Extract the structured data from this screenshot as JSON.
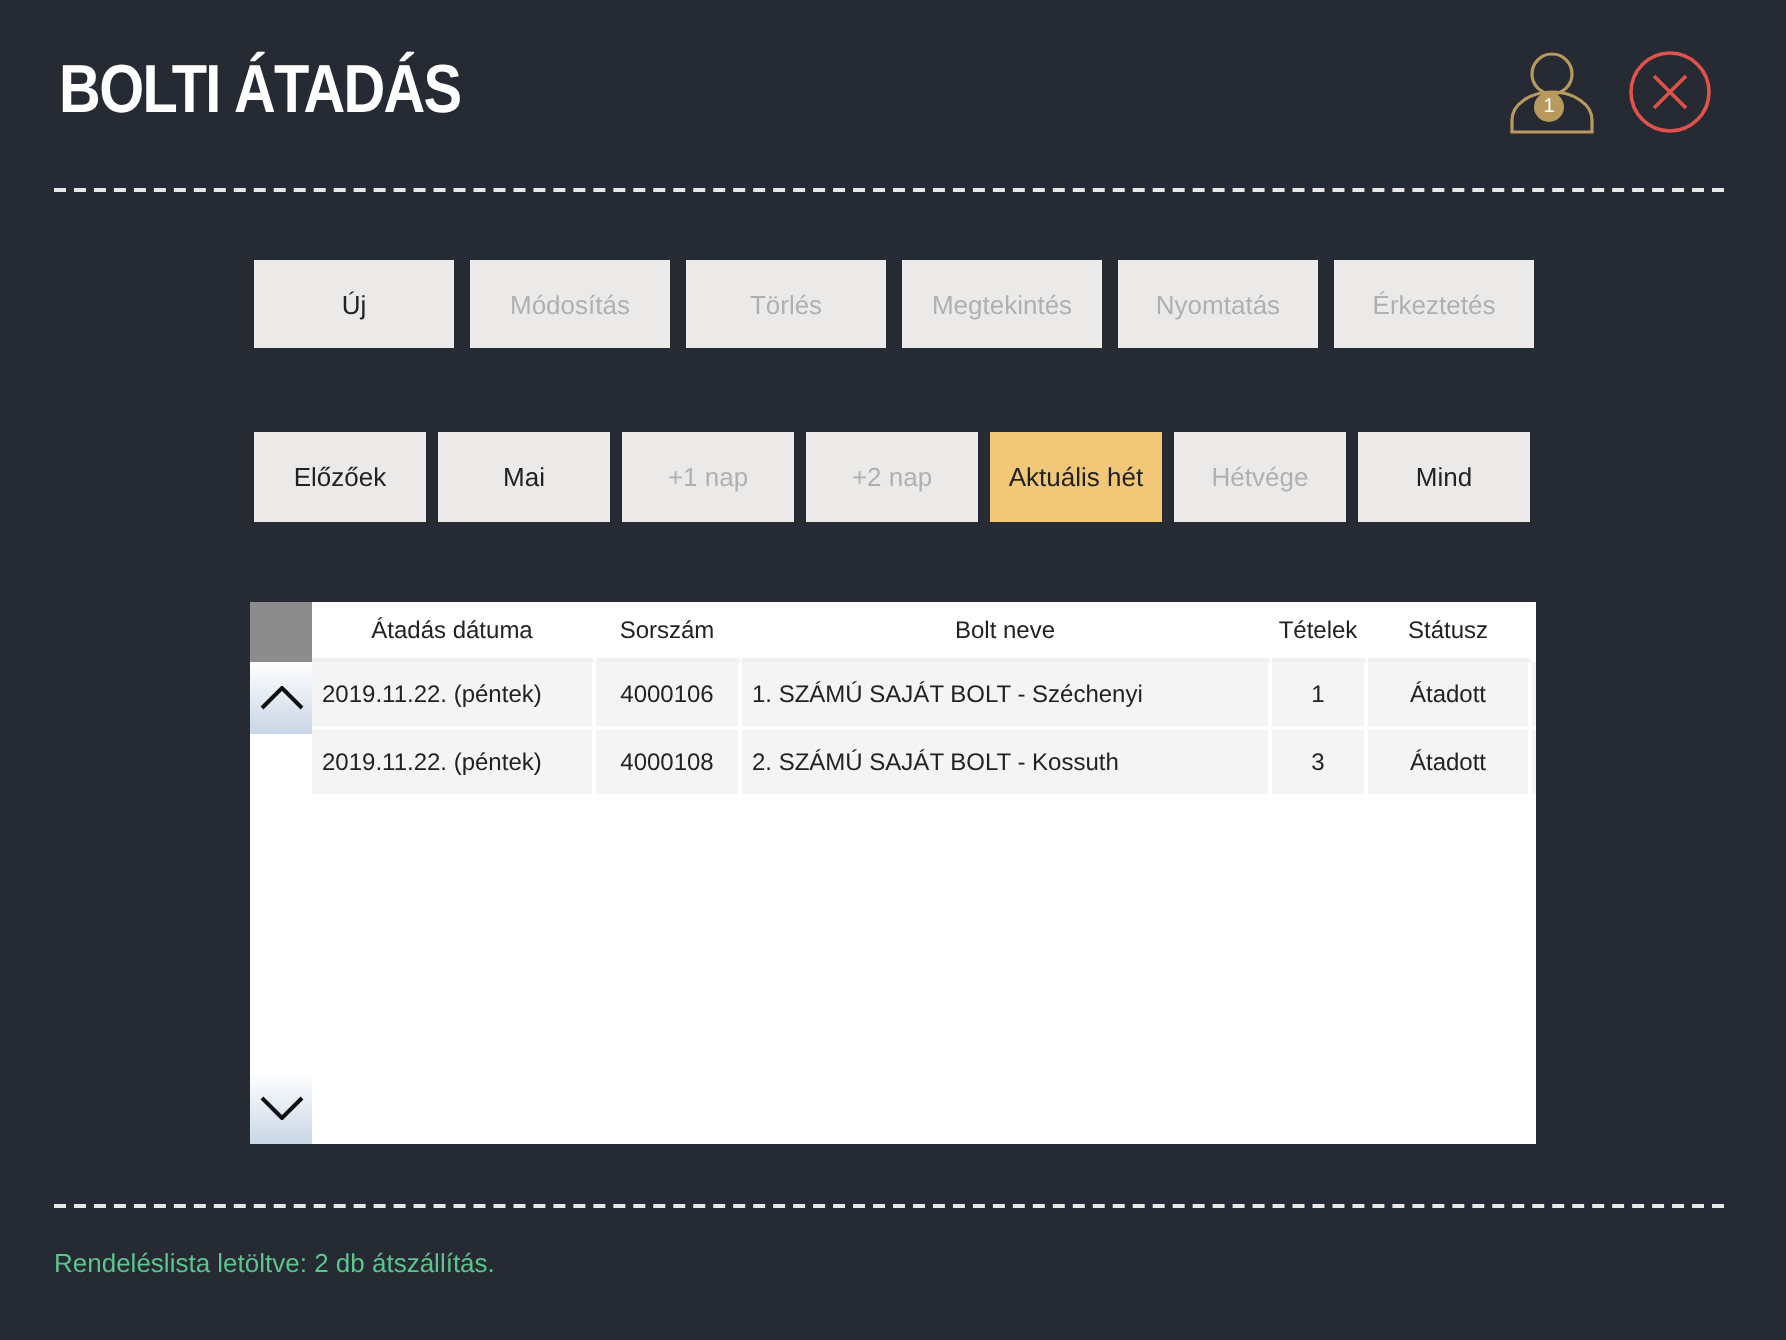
{
  "header": {
    "title": "BOLTI ÁTADÁS",
    "user_badge": "1"
  },
  "actions": [
    {
      "label": "Új",
      "disabled": false
    },
    {
      "label": "Módosítás",
      "disabled": true
    },
    {
      "label": "Törlés",
      "disabled": true
    },
    {
      "label": "Megtekintés",
      "disabled": true
    },
    {
      "label": "Nyomtatás",
      "disabled": true
    },
    {
      "label": "Érkeztetés",
      "disabled": true
    }
  ],
  "filters": [
    {
      "label": "Előzőek",
      "selected": false,
      "disabled": false
    },
    {
      "label": "Mai",
      "selected": false,
      "disabled": false
    },
    {
      "label": "+1 nap",
      "selected": false,
      "disabled": true
    },
    {
      "label": "+2 nap",
      "selected": false,
      "disabled": true
    },
    {
      "label": "Aktuális hét",
      "selected": true,
      "disabled": false
    },
    {
      "label": "Hétvége",
      "selected": false,
      "disabled": true
    },
    {
      "label": "Mind",
      "selected": false,
      "disabled": false
    }
  ],
  "table": {
    "columns": [
      "Átadás dátuma",
      "Sorszám",
      "Bolt neve",
      "Tételek",
      "Státusz"
    ],
    "rows": [
      [
        "2019.11.22. (péntek)",
        "4000106",
        "1. SZÁMÚ SAJÁT BOLT - Széchenyi",
        "1",
        "Átadott"
      ],
      [
        "2019.11.22. (péntek)",
        "4000108",
        "2. SZÁMÚ SAJÁT BOLT - Kossuth",
        "3",
        "Átadott"
      ]
    ]
  },
  "status_bar": "Rendeléslista letöltve: 2 db átszállítás."
}
